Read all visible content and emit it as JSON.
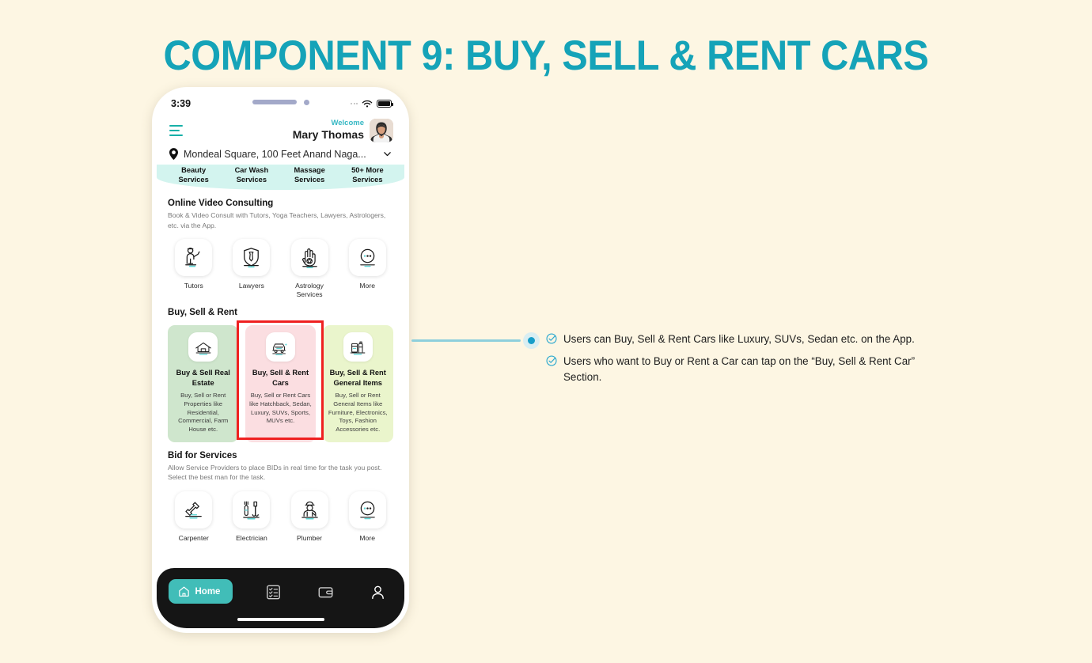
{
  "title": "COMPONENT 9: BUY, SELL & RENT CARS",
  "colors": {
    "page_background": "#fdf6e3",
    "title_teal": "#15a3b8",
    "accent_teal": "#17b0a8",
    "highlight_red": "#ef2020",
    "card_green": "#cfe6cd",
    "card_pink": "#fbdee1",
    "card_lime": "#eaf5cc",
    "mint_strip": "#d3f4ef",
    "nav_black": "#151515",
    "connector_teal": "#8ecfdc"
  },
  "phone": {
    "status_bar": {
      "time": "3:39",
      "icons": [
        "signal-dots-icon",
        "wifi-icon",
        "battery-icon"
      ]
    },
    "header": {
      "menu_icon": "hamburger-menu-icon",
      "welcome_label": "Welcome",
      "user_name": "Mary Thomas",
      "avatar": "user-avatar"
    },
    "location": {
      "pin_icon": "location-pin-icon",
      "text": "Mondeal Square, 100 Feet Anand Naga...",
      "chevron_icon": "chevron-down-icon"
    },
    "service_strip": [
      "Beauty\nServices",
      "Car Wash\nServices",
      "Massage\nServices",
      "50+ More\nServices"
    ],
    "sections": [
      {
        "title": "Online Video Consulting",
        "subtitle": "Book & Video Consult with Tutors, Yoga Teachers, Lawyers, Astrologers, etc. via the App.",
        "items": [
          {
            "label": "Tutors",
            "icon": "tutor-icon"
          },
          {
            "label": "Lawyers",
            "icon": "lawyer-shield-icon"
          },
          {
            "label": "Astrology Services",
            "icon": "astrology-palm-icon"
          },
          {
            "label": "More",
            "icon": "more-dots-icon"
          }
        ]
      }
    ],
    "buy_sell_rent": {
      "title": "Buy, Sell & Rent",
      "cards": [
        {
          "title": "Buy & Sell Real Estate",
          "desc": "Buy, Sell or Rent Properties like Residential, Commercial, Farm House etc.",
          "icon": "real-estate-icon",
          "highlighted": false
        },
        {
          "title": "Buy, Sell & Rent Cars",
          "desc": "Buy, Sell or Rent Cars like Hatchback, Sedan, Luxury, SUVs, Sports, MUVs  etc.",
          "icon": "car-icon",
          "highlighted": true
        },
        {
          "title": "Buy, Sell & Rent General Items",
          "desc": "Buy, Sell or Rent General Items like Furniture, Electronics, Toys, Fashion Accessories  etc.",
          "icon": "general-items-icon",
          "highlighted": false
        }
      ]
    },
    "bid_section": {
      "title": "Bid for Services",
      "subtitle": "Allow Service Providers to place BIDs in real time for the task you post. Select the best man for the task.",
      "items": [
        {
          "label": "Carpenter",
          "icon": "carpenter-hammer-icon"
        },
        {
          "label": "Electrician",
          "icon": "electrician-tools-icon"
        },
        {
          "label": "Plumber",
          "icon": "plumber-icon"
        },
        {
          "label": "More",
          "icon": "more-dots-icon"
        }
      ]
    },
    "bottom_nav": [
      {
        "label": "Home",
        "icon": "home-icon",
        "active": true
      },
      {
        "label": "",
        "icon": "checklist-icon",
        "active": false
      },
      {
        "label": "",
        "icon": "wallet-icon",
        "active": false
      },
      {
        "label": "",
        "icon": "person-icon",
        "active": false
      }
    ]
  },
  "annotations": [
    "Users can Buy, Sell & Rent Cars like Luxury, SUVs, Sedan etc. on the App.",
    "Users who want to Buy or Rent a Car can tap on the “Buy, Sell & Rent Car” Section."
  ]
}
